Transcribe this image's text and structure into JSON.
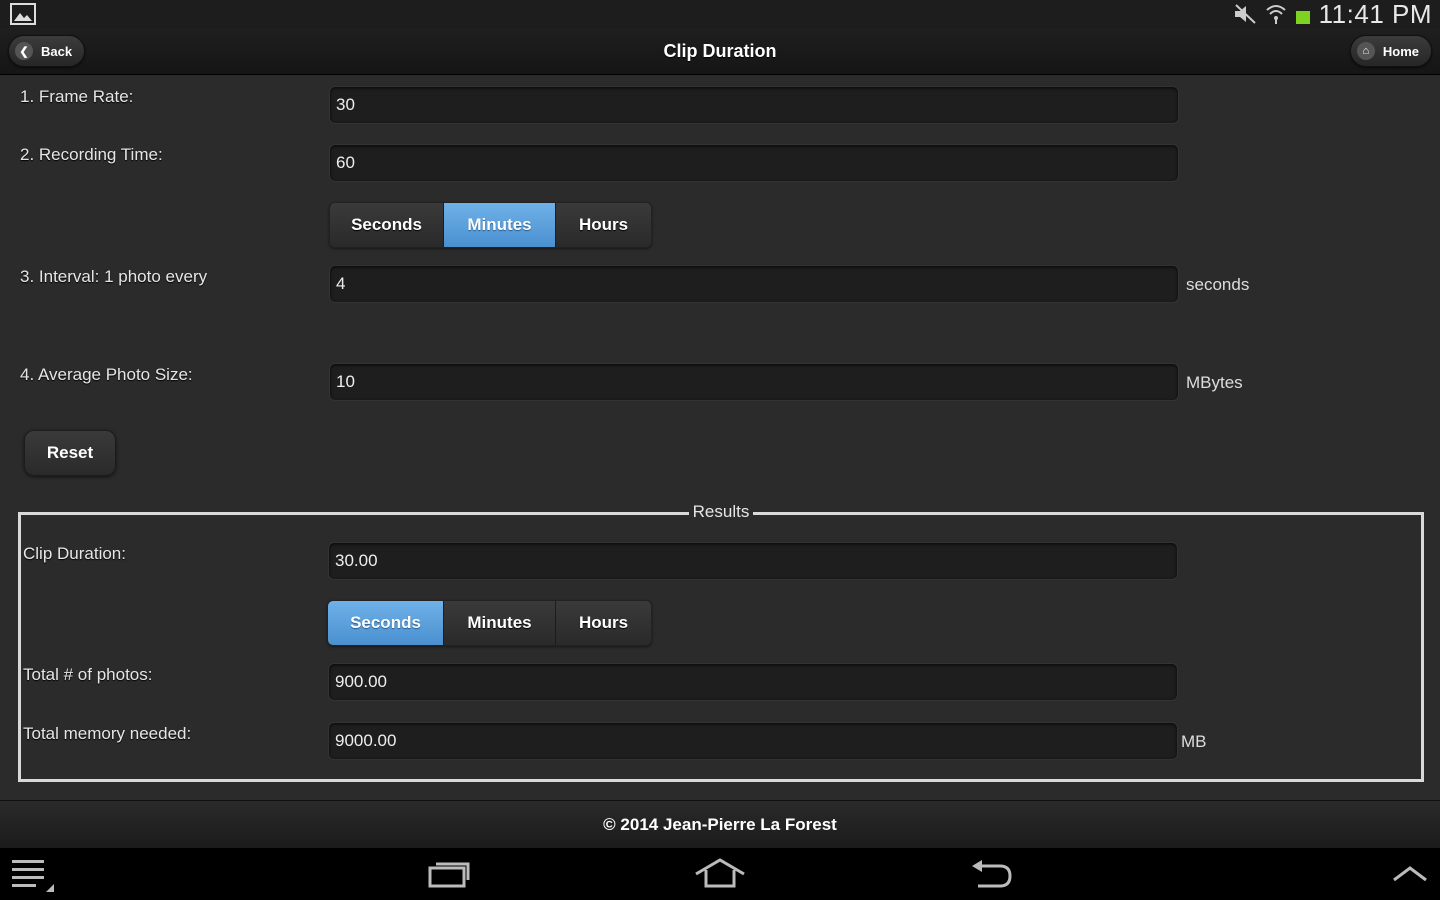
{
  "status_bar": {
    "time": "11:41 PM"
  },
  "header": {
    "back_label": "Back",
    "title": "Clip Duration",
    "home_label": "Home"
  },
  "form": {
    "frame_rate": {
      "label": "1. Frame Rate:",
      "value": "30"
    },
    "recording_time": {
      "label": "2. Recording Time:",
      "value": "60"
    },
    "recording_units": {
      "options": [
        "Seconds",
        "Minutes",
        "Hours"
      ],
      "selected": "Minutes"
    },
    "interval": {
      "label": "3. Interval: 1 photo every",
      "value": "4",
      "unit": "seconds"
    },
    "photo_size": {
      "label": "4. Average Photo Size:",
      "value": "10",
      "unit": "MBytes"
    },
    "reset_label": "Reset"
  },
  "results": {
    "legend": "Results",
    "clip_duration": {
      "label": "Clip Duration:",
      "value": "30.00"
    },
    "duration_units": {
      "options": [
        "Seconds",
        "Minutes",
        "Hours"
      ],
      "selected": "Seconds"
    },
    "total_photos": {
      "label": "Total # of photos:",
      "value": "900.00"
    },
    "total_memory": {
      "label": "Total memory needed:",
      "value": "9000.00",
      "unit": "MB"
    }
  },
  "footer": {
    "text": "© 2014 Jean-Pierre La Forest"
  },
  "colors": {
    "accent": "#5a9fdc",
    "background": "#2b2b2b",
    "field": "#1e1e1e"
  }
}
